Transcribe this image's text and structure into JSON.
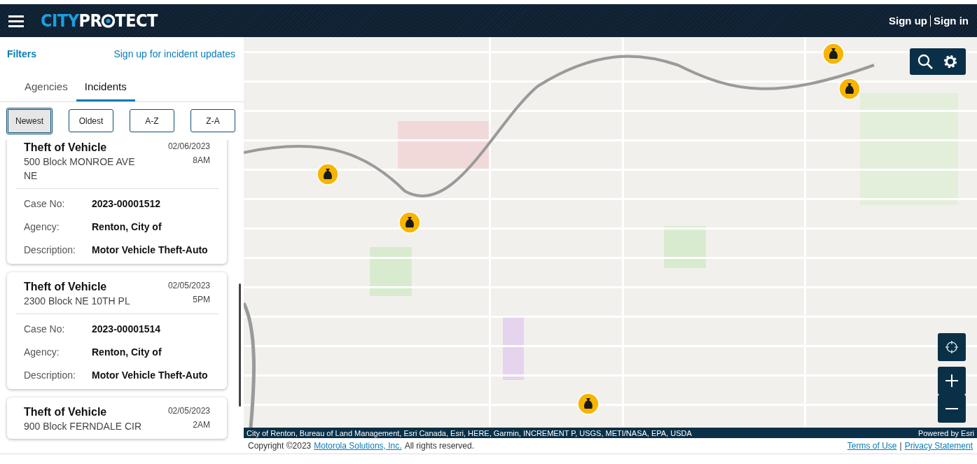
{
  "header": {
    "logo_left": "CITY",
    "logo_right": "PR",
    "logo_end": "TECT",
    "auth_links": [
      {
        "label": "Sign up"
      },
      {
        "label": "Sign in"
      }
    ]
  },
  "panel": {
    "filters_link": "Filters",
    "signup_link": "Sign up for incident updates",
    "tabs": [
      {
        "label": "Agencies",
        "selected": false
      },
      {
        "label": "Incidents",
        "selected": true
      }
    ],
    "sort_buttons": [
      {
        "label": "Newest",
        "selected": true
      },
      {
        "label": "Oldest",
        "selected": false
      },
      {
        "label": "A-Z",
        "selected": false
      },
      {
        "label": "Z-A",
        "selected": false
      }
    ],
    "incidents": [
      {
        "title": "Theft of Vehicle",
        "address": "500 Block MONROE AVE NE",
        "date": "02/06/2023",
        "time": "8AM",
        "fields": [
          {
            "label": "Case No:",
            "value": "2023-00001512"
          },
          {
            "label": "Agency:",
            "value": "Renton, City of"
          },
          {
            "label": "Description:",
            "value": "Motor Vehicle Theft-Auto"
          }
        ]
      },
      {
        "title": "Theft of Vehicle",
        "address": "2300 Block NE 10TH PL",
        "date": "02/05/2023",
        "time": "5PM",
        "fields": [
          {
            "label": "Case No:",
            "value": "2023-00001514"
          },
          {
            "label": "Agency:",
            "value": "Renton, City of"
          },
          {
            "label": "Description:",
            "value": "Motor Vehicle Theft-Auto"
          }
        ]
      },
      {
        "title": "Theft of Vehicle",
        "address": "900 Block FERNDALE CIR",
        "date": "02/05/2023",
        "time": "2AM"
      }
    ]
  },
  "map": {
    "kind": "picture",
    "attribution": "City of Renton, Bureau of Land Management, Esri Canada, Esri, HERE, Garmin, INCREMENT P, USGS, METI/NASA, EPA, USDA",
    "powered_by": "Powered by Esri"
  },
  "footer": {
    "copyright": "Copyright ©2023",
    "company_link": "Motorola Solutions, Inc.",
    "rights": "All rights reserved.",
    "links": [
      {
        "label": "Terms of Use"
      },
      {
        "label": "Privacy Statement"
      }
    ],
    "separator": "|"
  }
}
